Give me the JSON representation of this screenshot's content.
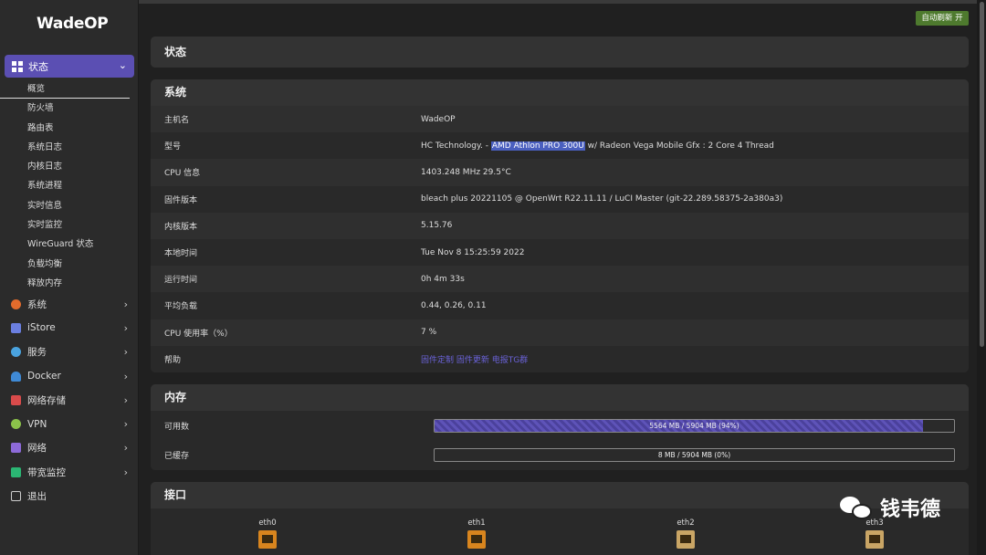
{
  "app": {
    "logo": "WadeOP"
  },
  "sidebar": {
    "active": {
      "label": "状态",
      "icon": "dashboard-icon"
    },
    "sub_items": [
      "概览",
      "防火墙",
      "路由表",
      "系统日志",
      "内核日志",
      "系统进程",
      "实时信息",
      "实时监控",
      "WireGuard 状态",
      "负载均衡",
      "释放内存"
    ],
    "menu": [
      {
        "label": "系统",
        "icon": "gear-icon",
        "color": "#e26b2c"
      },
      {
        "label": "iStore",
        "icon": "cube-icon",
        "color": "#6b7fe0"
      },
      {
        "label": "服务",
        "icon": "link-icon",
        "color": "#4aa3df"
      },
      {
        "label": "Docker",
        "icon": "docker-icon",
        "color": "#3f8ad6"
      },
      {
        "label": "网络存储",
        "icon": "database-icon",
        "color": "#d94b4b"
      },
      {
        "label": "VPN",
        "icon": "vpn-icon",
        "color": "#8bc34a"
      },
      {
        "label": "网络",
        "icon": "network-icon",
        "color": "#8d6ad8"
      },
      {
        "label": "带宽监控",
        "icon": "monitor-icon",
        "color": "#2bb673"
      },
      {
        "label": "退出",
        "icon": "logout-icon",
        "color": "#cccccc"
      }
    ]
  },
  "topbar": {
    "refresh_label": "自动刷新 开"
  },
  "status": {
    "title": "状态"
  },
  "system": {
    "title": "系统",
    "rows": [
      {
        "key": "主机名",
        "value": "WadeOP"
      },
      {
        "key": "型号",
        "value_pre": "HC Technology. - ",
        "value_hl": "AMD Athlon PRO 300U",
        "value_post": " w/ Radeon Vega Mobile Gfx : 2 Core 4 Thread"
      },
      {
        "key": "CPU 信息",
        "value": "1403.248 MHz 29.5°C"
      },
      {
        "key": "固件版本",
        "value": "bleach plus 20221105 @ OpenWrt R22.11.11 / LuCI Master (git-22.289.58375-2a380a3)"
      },
      {
        "key": "内核版本",
        "value": "5.15.76"
      },
      {
        "key": "本地时间",
        "value": "Tue Nov 8 15:25:59 2022"
      },
      {
        "key": "运行时间",
        "value": "0h 4m 33s"
      },
      {
        "key": "平均负载",
        "value": "0.44, 0.26, 0.11"
      },
      {
        "key": "CPU 使用率（%）",
        "value": "7 %"
      },
      {
        "key": "帮助",
        "value": "固件定制 固件更新 电报TG群"
      }
    ]
  },
  "memory": {
    "title": "内存",
    "rows": [
      {
        "key": "可用数",
        "text": "5564 MB / 5904 MB (94%)",
        "percent": 94
      },
      {
        "key": "已缓存",
        "text": "8 MB / 5904 MB (0%)",
        "percent": 0
      }
    ]
  },
  "interfaces": {
    "title": "接口",
    "items": [
      {
        "name": "eth0",
        "state": "up"
      },
      {
        "name": "eth1",
        "state": "up"
      },
      {
        "name": "eth2",
        "state": "down"
      },
      {
        "name": "eth3",
        "state": "down"
      }
    ]
  },
  "watermark": {
    "text": "钱韦德"
  }
}
